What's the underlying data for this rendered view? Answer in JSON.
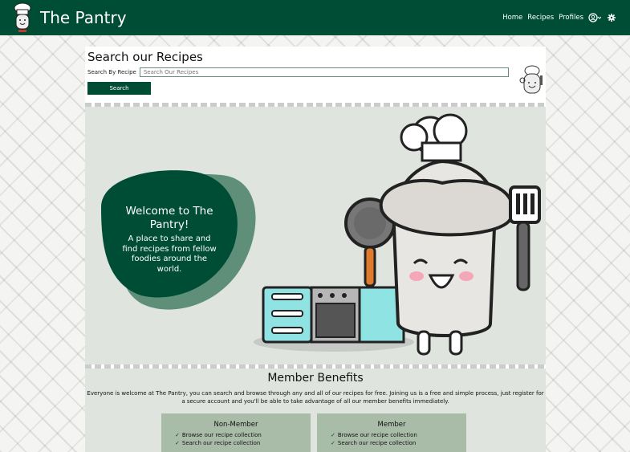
{
  "navbar": {
    "brand": "The Pantry",
    "links": [
      "Home",
      "Recipes",
      "Profiles"
    ]
  },
  "search": {
    "title": "Search our Recipes",
    "label": "Search By Recipe",
    "placeholder": "Search Our Recipes",
    "button": "Search"
  },
  "hero": {
    "title": "Welcome to The Pantry!",
    "subtitle": "A place to share and find recipes from fellow foodies around the world."
  },
  "benefits": {
    "title": "Member Benefits",
    "description": "Everyone is welcome at The Pantry, you can search and browse through any and all of our recipes for free. Joining us is a free and simple process, just register for a secure account and you'll be able to take advantage of all our member benefits immediately.",
    "non_member": {
      "title": "Non-Member",
      "items": [
        "Browse our recipe collection",
        "Search our recipe collection"
      ]
    },
    "member": {
      "title": "Member",
      "items": [
        "Browse our recipe collection",
        "Search our recipe collection"
      ]
    }
  },
  "colors": {
    "brand_green": "#004d35",
    "hero_bg": "#dfe4df",
    "card_bg": "#a9bca8"
  },
  "icons": {
    "profile": "user-circle-icon",
    "settings": "gear-icon",
    "check": "check-icon"
  }
}
